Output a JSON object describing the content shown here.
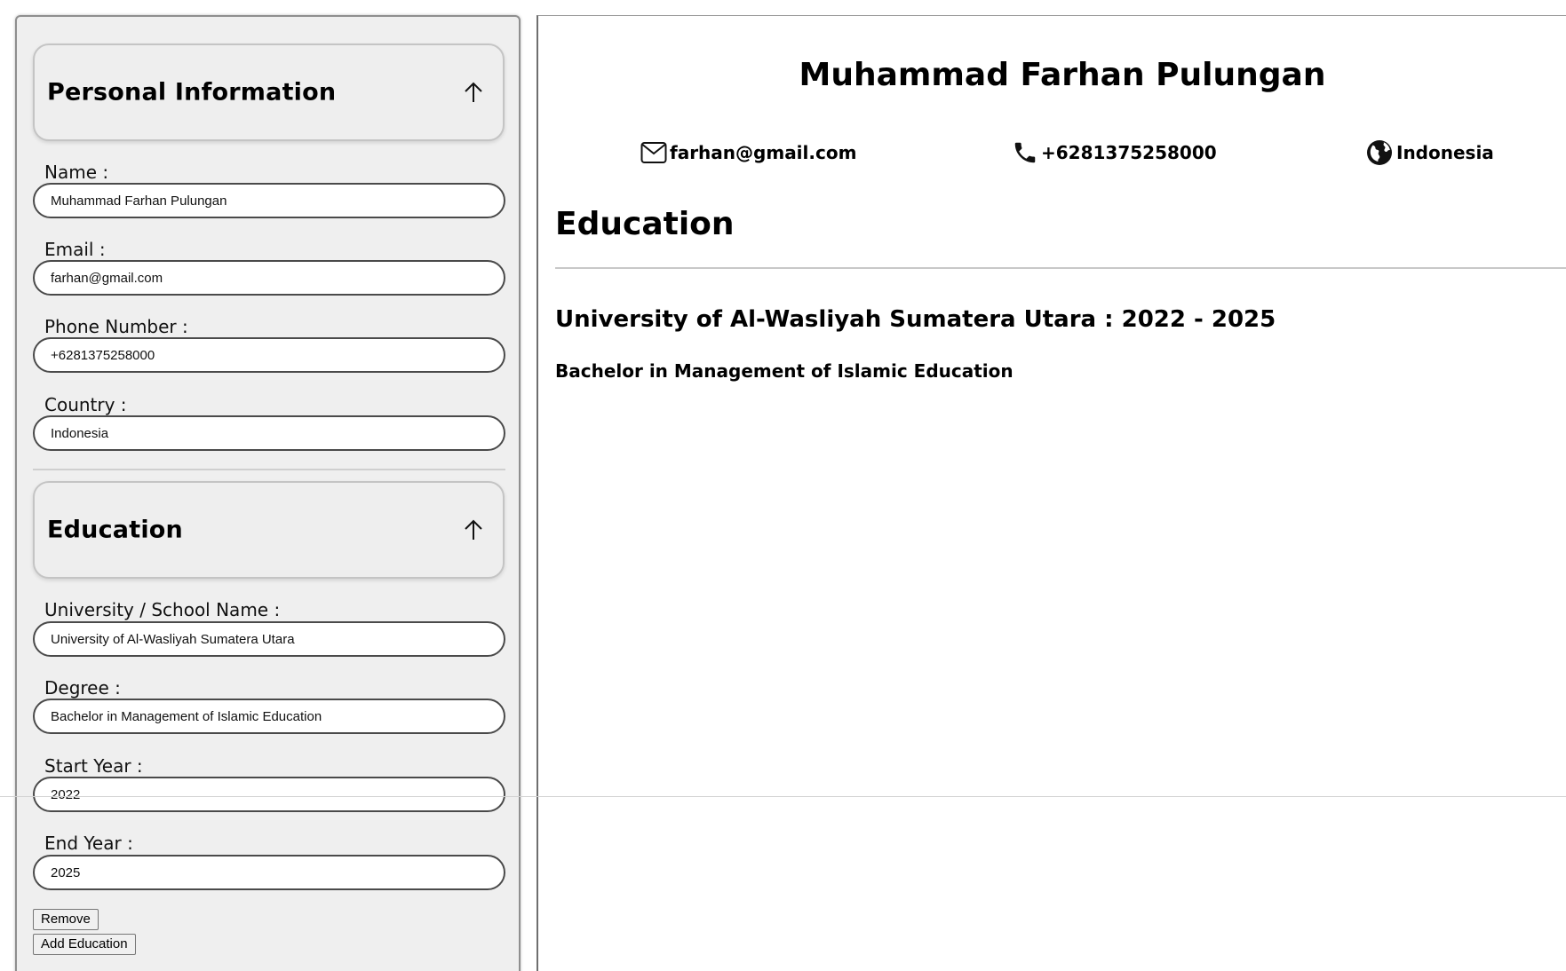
{
  "editor": {
    "personal": {
      "header": "Personal Information",
      "fields": {
        "name": {
          "label": "Name :",
          "value": "Muhammad Farhan Pulungan"
        },
        "email": {
          "label": "Email :",
          "value": "farhan@gmail.com"
        },
        "phone": {
          "label": "Phone Number :",
          "value": "+6281375258000"
        },
        "country": {
          "label": "Country :",
          "value": "Indonesia"
        }
      }
    },
    "education": {
      "header": "Education",
      "fields": {
        "school": {
          "label": "University / School Name :",
          "value": "University of Al-Wasliyah Sumatera Utara"
        },
        "degree": {
          "label": "Degree :",
          "value": "Bachelor in Management of Islamic Education"
        },
        "start": {
          "label": "Start Year :",
          "value": "2022"
        },
        "end": {
          "label": "End Year :",
          "value": "2025"
        }
      },
      "remove_label": "Remove",
      "add_label": "Add Education"
    },
    "icons": {
      "section_toggle": "arrow-up-icon"
    }
  },
  "preview": {
    "name": "Muhammad Farhan Pulungan",
    "contacts": {
      "email": {
        "icon": "envelope-icon",
        "text": "farhan@gmail.com"
      },
      "phone": {
        "icon": "phone-icon",
        "text": "+6281375258000"
      },
      "country": {
        "icon": "globe-icon",
        "text": "Indonesia"
      }
    },
    "education_title": "Education",
    "education_entry": {
      "school_line": "University of Al-Wasliyah Sumatera Utara : 2022 - 2025",
      "degree": "Bachelor in Management of Islamic Education"
    }
  },
  "colors": {
    "panel_bg": "#efefef",
    "input_border": "#4a4a4a",
    "text": "#000000"
  }
}
